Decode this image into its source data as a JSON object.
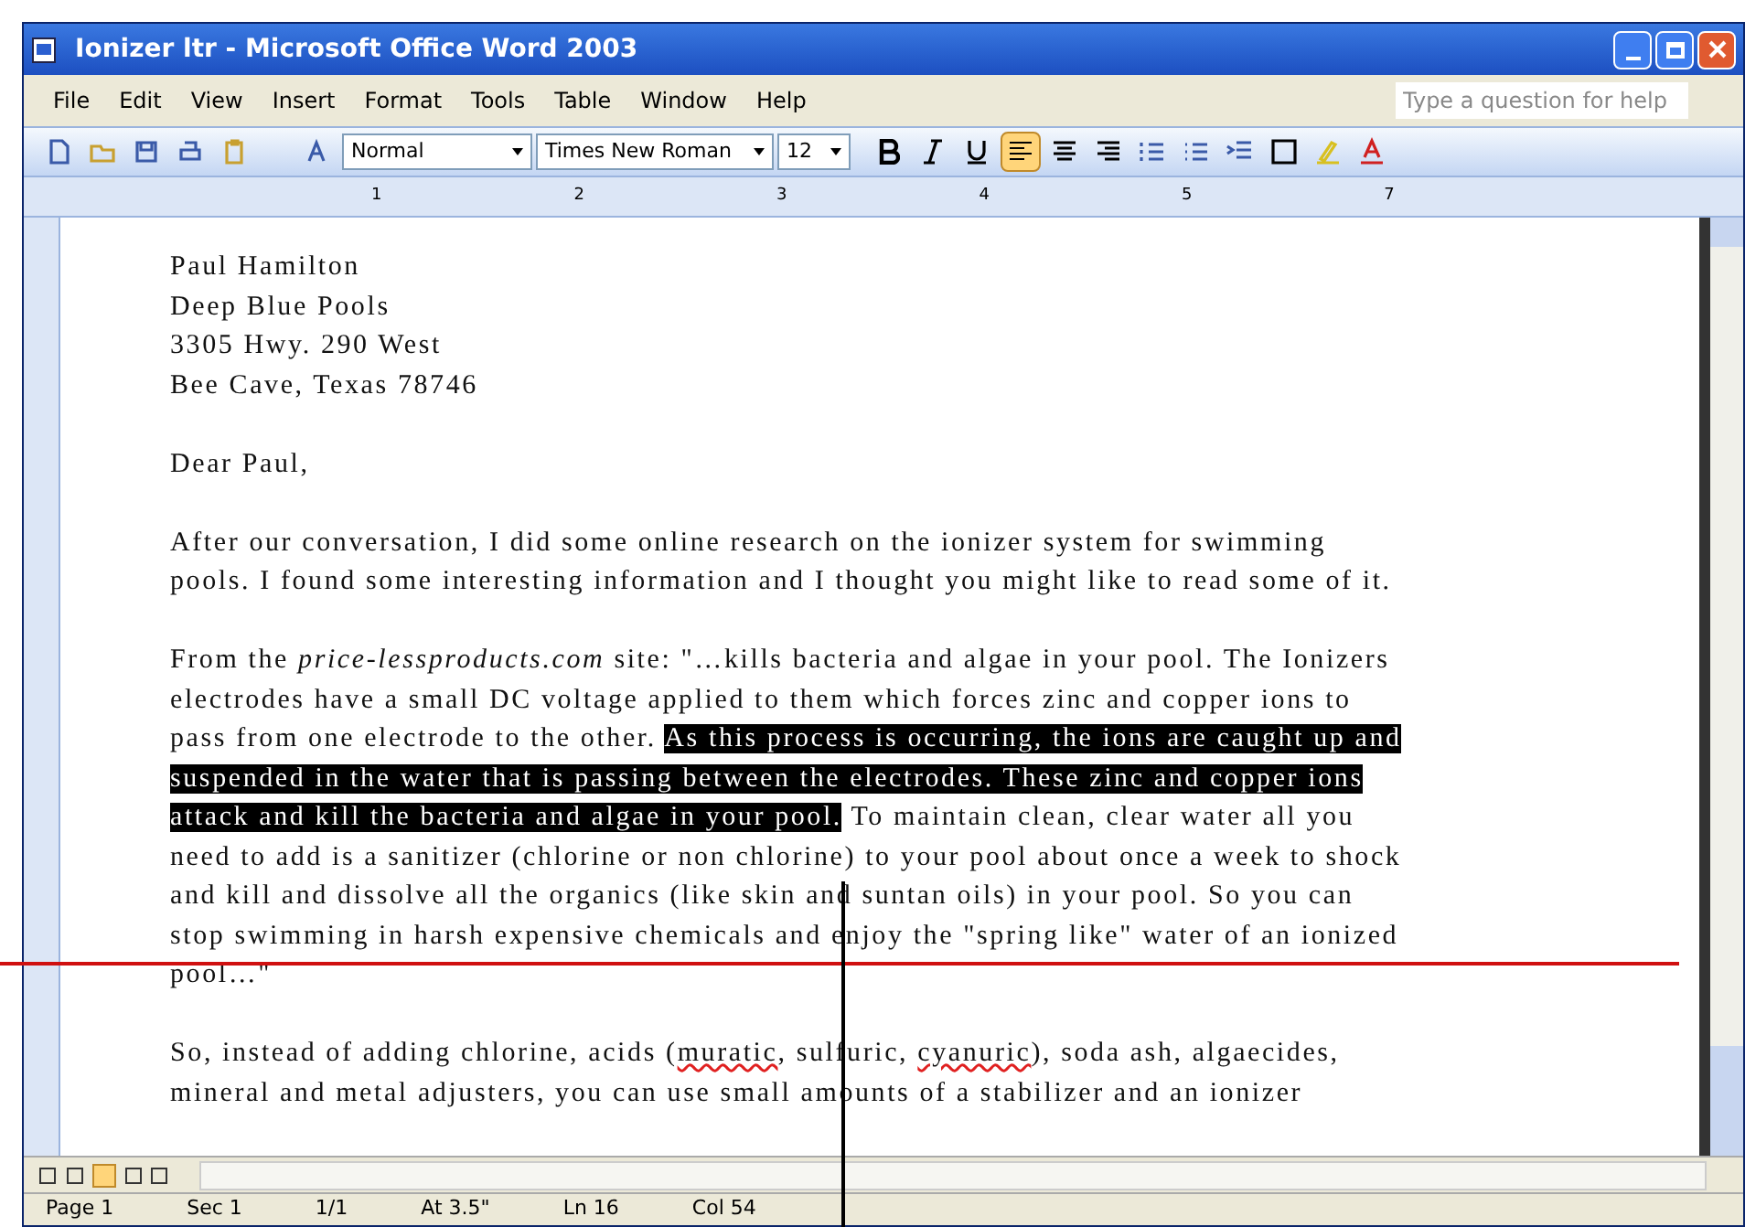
{
  "window": {
    "title": "Ionizer ltr - Microsoft Office Word 2003"
  },
  "menu": [
    "File",
    "Edit",
    "View",
    "Insert",
    "Format",
    "Tools",
    "Table",
    "Window",
    "Help"
  ],
  "help_search": {
    "placeholder": "Type a question for help"
  },
  "toolbar": {
    "style": "Normal",
    "font": "Times New Roman",
    "size": "12",
    "bold": false,
    "italic": false,
    "underline": false,
    "align_left": true
  },
  "ruler": [
    "1",
    "2",
    "3",
    "4",
    "5",
    "7"
  ],
  "document": {
    "paragraphs": [
      {
        "lines": [
          "Paul Hamilton",
          "Deep Blue Pools",
          "3305 Hwy. 290 West",
          "Bee Cave, Texas 78746"
        ]
      },
      {
        "segments": [
          {
            "text": "Dear Paul,",
            "selected": false
          }
        ]
      },
      {
        "segments": [
          {
            "text": "After our conversation, I did some online research on the ionizer system for swimming pools. I found some interesting information and I thought you might like to read some of it.",
            "selected": false
          }
        ]
      },
      {
        "segments": [
          {
            "text": "From the *price-lessproducts.com* site: \"…kills bacteria and algae in your pool.  The Ionizers electrodes have a small DC voltage applied to them which forces zinc and copper ions to pass from one electrode to the other. ",
            "selected": false
          },
          {
            "text": "As this process is occurring, the ions are caught up and suspended in the water that is passing between the electrodes.  These zinc and copper ions attack and kill the bacteria and algae in your pool.",
            "selected": true
          },
          {
            "text": "  To maintain clean, clear water all you need to add is a sanitizer (chlorine or non chlorine) to your pool about once a week to shock and kill and dissolve all the organics (like skin and suntan oils) in your pool.  So you can stop swimming in harsh expensive chemicals and enjoy the \"spring like\" water of an ionized pool…\"",
            "selected": false
          }
        ]
      },
      {
        "segments": [
          {
            "text": "So, instead of adding chlorine, acids (",
            "selected": false
          },
          {
            "text": "muratic",
            "selected": false,
            "misspelled": true
          },
          {
            "text": ", sulfuric, ",
            "selected": false
          },
          {
            "text": "cyanuric",
            "selected": false,
            "misspelled": true
          },
          {
            "text": "), soda ash, algaecides, mineral and metal adjusters, you can use small amounts of a stabilizer and an ionizer",
            "selected": false
          }
        ]
      }
    ]
  },
  "status_bar": [
    "Page 1",
    "Sec 1",
    "1/1",
    "At 3.5\"",
    "Ln 16",
    "Col 54"
  ]
}
